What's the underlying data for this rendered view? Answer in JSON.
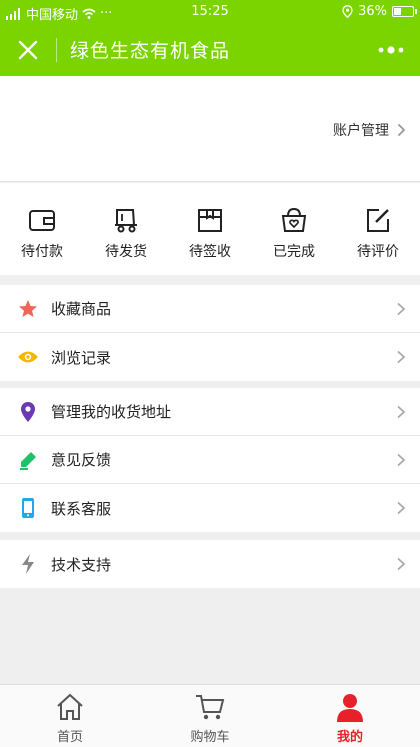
{
  "status_bar": {
    "carrier": "中国移动",
    "dots": "···",
    "time": "15:25",
    "battery": "36%",
    "battery_level": 0.36
  },
  "navbar": {
    "title": "绿色生态有机食品",
    "close_icon": "close-icon",
    "more_icon": "more-icon"
  },
  "profile": {
    "account_manage": "账户管理"
  },
  "orders": [
    {
      "label": "待付款",
      "icon": "wallet-icon"
    },
    {
      "label": "待发货",
      "icon": "truck-icon"
    },
    {
      "label": "待签收",
      "icon": "package-icon"
    },
    {
      "label": "已完成",
      "icon": "basket-heart-icon"
    },
    {
      "label": "待评价",
      "icon": "edit-icon"
    }
  ],
  "menu": {
    "group1": [
      {
        "label": "收藏商品",
        "icon": "star-icon",
        "color": "#f0655a"
      },
      {
        "label": "浏览记录",
        "icon": "eye-icon",
        "color": "#f5b800"
      }
    ],
    "group2": [
      {
        "label": "管理我的收货地址",
        "icon": "location-icon",
        "color": "#6a3ab4"
      },
      {
        "label": "意见反馈",
        "icon": "pencil-icon",
        "color": "#22c06a"
      },
      {
        "label": "联系客服",
        "icon": "phone-icon",
        "color": "#22a8e8"
      }
    ],
    "group3": [
      {
        "label": "技术支持",
        "icon": "lightning-icon",
        "color": "#888888"
      }
    ]
  },
  "tabbar": [
    {
      "label": "首页",
      "icon": "home-icon",
      "active": false
    },
    {
      "label": "购物车",
      "icon": "cart-icon",
      "active": false
    },
    {
      "label": "我的",
      "icon": "user-icon",
      "active": true
    }
  ],
  "colors": {
    "brand_green": "#7bd400",
    "active_red": "#e8202a"
  }
}
